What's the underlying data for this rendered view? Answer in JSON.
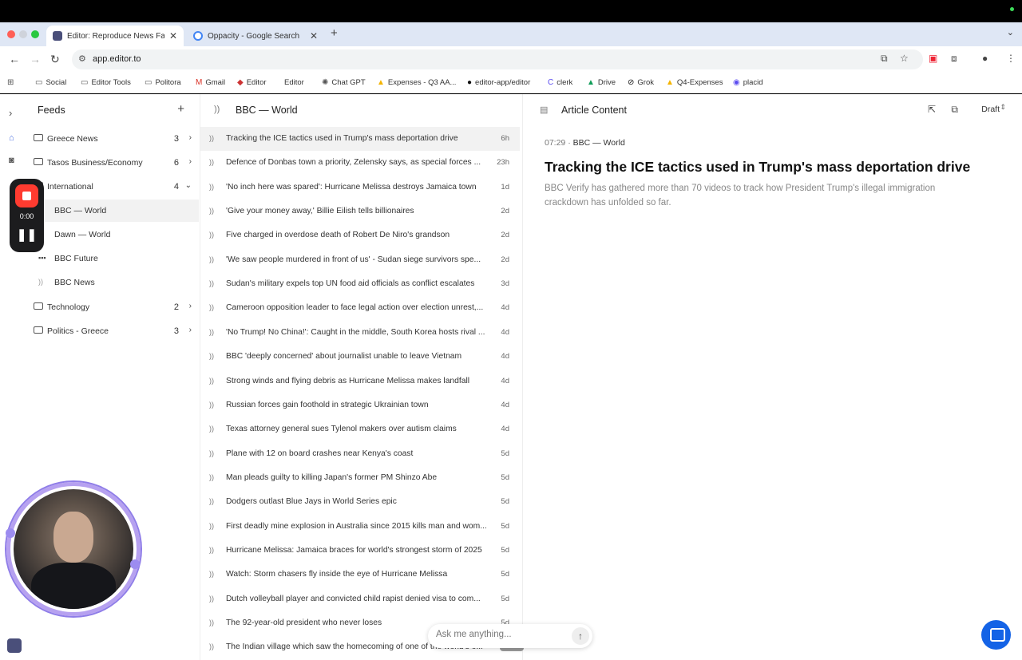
{
  "browser": {
    "tabs": [
      {
        "title": "Editor: Reproduce News Fast",
        "active": true
      },
      {
        "title": "Oppacity - Google Search",
        "active": false
      }
    ],
    "url": "app.editor.to",
    "bookmarks": [
      "Social",
      "Editor Tools",
      "Politora",
      "Gmail",
      "Editor",
      "Editor",
      "Chat GPT",
      "Expenses - Q3 AA...",
      "editor-app/editor",
      "clerk",
      "Drive",
      "Grok",
      "Q4-Expenses",
      "placid"
    ]
  },
  "recorder": {
    "time": "0:00"
  },
  "feeds": {
    "title": "Feeds",
    "folders": [
      {
        "name": "Greece News",
        "count": "3"
      },
      {
        "name": "Tasos Business/Economy",
        "count": "6"
      },
      {
        "name": "International",
        "count": "4"
      },
      {
        "name": "Technology",
        "count": "2"
      },
      {
        "name": "Politics - Greece",
        "count": "3"
      }
    ],
    "international_feeds": [
      "BBC — World",
      "Dawn — World",
      "BBC Future",
      "BBC News"
    ]
  },
  "list": {
    "title": "BBC — World",
    "articles": [
      {
        "title": "Tracking the ICE tactics used in Trump's mass deportation drive",
        "age": "6h"
      },
      {
        "title": "Defence of Donbas town a priority, Zelensky says, as special forces ...",
        "age": "23h"
      },
      {
        "title": "'No inch here was spared': Hurricane Melissa destroys Jamaica town",
        "age": "1d"
      },
      {
        "title": "'Give your money away,' Billie Eilish tells billionaires",
        "age": "2d"
      },
      {
        "title": "Five charged in overdose death of Robert De Niro's grandson",
        "age": "2d"
      },
      {
        "title": "'We saw people murdered in front of us' - Sudan siege survivors spe...",
        "age": "2d"
      },
      {
        "title": "Sudan's military expels top UN food aid officials as conflict escalates",
        "age": "3d"
      },
      {
        "title": "Cameroon opposition leader to face legal action over election unrest,...",
        "age": "4d"
      },
      {
        "title": "'No Trump! No China!': Caught in the middle, South Korea hosts rival ...",
        "age": "4d"
      },
      {
        "title": "BBC 'deeply concerned' about journalist unable to leave Vietnam",
        "age": "4d"
      },
      {
        "title": "Strong winds and flying debris as Hurricane Melissa makes landfall",
        "age": "4d"
      },
      {
        "title": "Russian forces gain foothold in strategic Ukrainian town",
        "age": "4d"
      },
      {
        "title": "Texas attorney general sues Tylenol makers over autism claims",
        "age": "4d"
      },
      {
        "title": "Plane with 12 on board crashes near Kenya's coast",
        "age": "5d"
      },
      {
        "title": "Man pleads guilty to killing Japan's former PM Shinzo Abe",
        "age": "5d"
      },
      {
        "title": "Dodgers outlast Blue Jays in World Series epic",
        "age": "5d"
      },
      {
        "title": "First deadly mine explosion in Australia since 2015 kills man and wom...",
        "age": "5d"
      },
      {
        "title": "Hurricane Melissa: Jamaica braces for world's strongest storm of 2025",
        "age": "5d"
      },
      {
        "title": "Watch: Storm chasers fly inside the eye of Hurricane Melissa",
        "age": "5d"
      },
      {
        "title": "Dutch volleyball player and convicted child rapist denied visa to com...",
        "age": "5d"
      },
      {
        "title": "The 92-year-old president who never loses",
        "age": "5d"
      },
      {
        "title": "The Indian village which saw the homecoming of one of the world's o...",
        "age": ""
      }
    ]
  },
  "detail": {
    "header": "Article Content",
    "status": "Draft",
    "time": "07:29",
    "source": "BBC — World",
    "headline": "Tracking the ICE tactics used in Trump's mass deportation drive",
    "summary": "BBC Verify has gathered more than 70 videos to track how President Trump's illegal immigration crackdown has unfolded so far."
  },
  "ask": {
    "placeholder": "Ask me anything..."
  }
}
